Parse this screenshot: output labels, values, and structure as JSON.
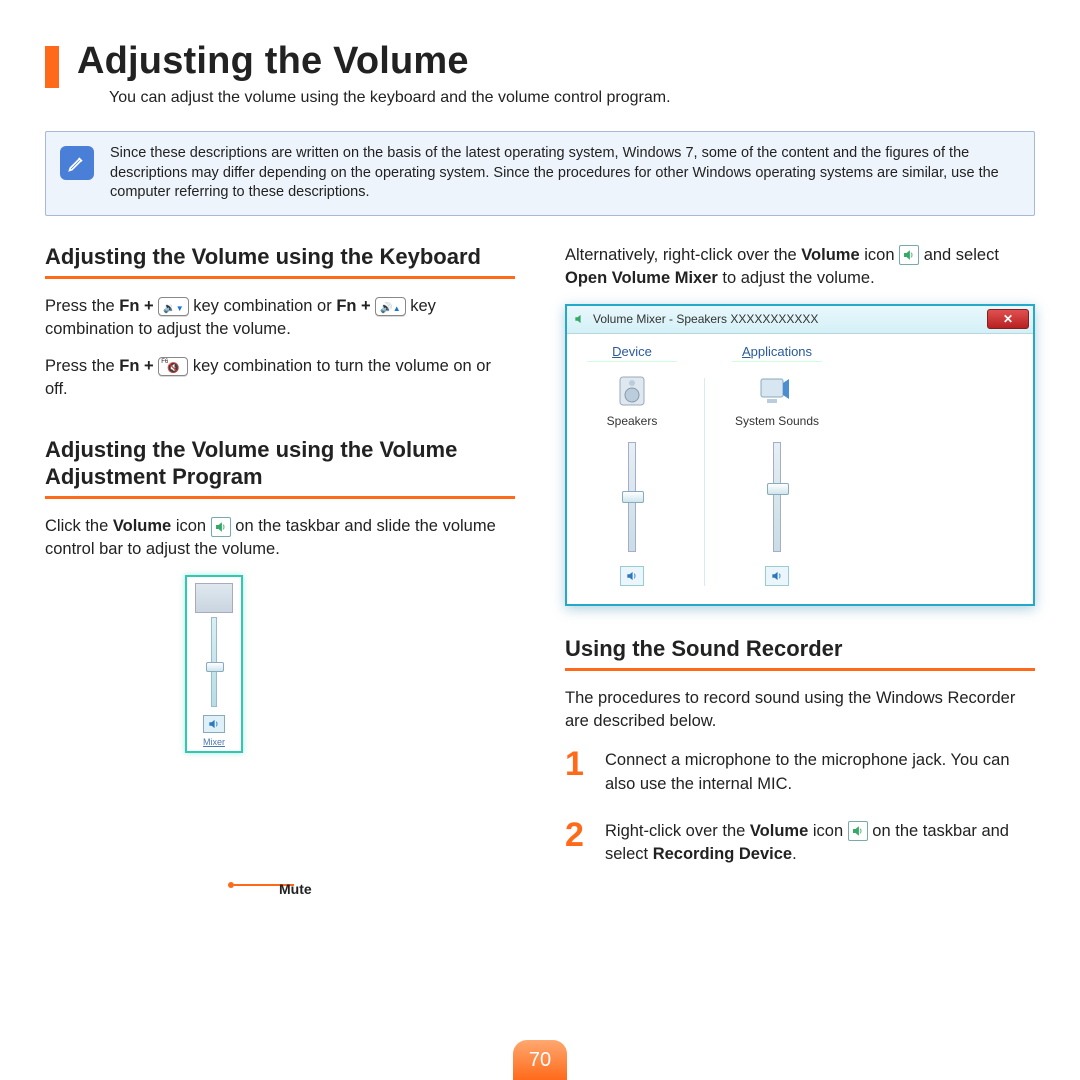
{
  "page_number": "70",
  "title": "Adjusting the Volume",
  "intro": "You can adjust the volume using the keyboard and the volume control program.",
  "note": "Since these descriptions are written on the basis of the latest operating system, Windows 7, some of the content and the figures of the descriptions may differ depending on the operating system. Since the procedures for other Windows operating systems are similar, use the computer referring to these descriptions.",
  "left": {
    "h_keyboard": "Adjusting the Volume using the Keyboard",
    "p1_a": "Press the ",
    "p1_b": "Fn + ",
    "p1_c": " key combination or ",
    "p1_d": "Fn + ",
    "p1_e": " key combination to adjust the volume.",
    "p2_a": "Press the ",
    "p2_b": "Fn + ",
    "p2_c": " key combination to turn the volume on or off.",
    "h_program": "Adjusting the Volume using the Volume Adjustment Program",
    "p3_a": "Click the ",
    "p3_b": "Volume",
    "p3_c": " icon ",
    "p3_d": " on the taskbar and slide the volume control bar to adjust the volume.",
    "mute": "Mute",
    "mixer_link": "Mixer"
  },
  "right": {
    "p1_a": "Alternatively, right-click over the ",
    "p1_b": "Volume",
    "p1_c": " icon ",
    "p1_d": " and select ",
    "p1_e": "Open Volume Mixer",
    "p1_f": " to adjust the volume.",
    "mixer": {
      "title": "Volume Mixer - Speakers  XXXXXXXXXXX",
      "col1_hdr": "Device",
      "col1_label": "Speakers",
      "col2_hdr": "Applications",
      "col2_label": "System Sounds"
    },
    "h_recorder": "Using the Sound Recorder",
    "p_recorder": "The procedures to record sound using the Windows Recorder are described below.",
    "steps": {
      "s1_num": "1",
      "s1_a": "Connect a microphone to the microphone jack. You can also use the internal MIC.",
      "s2_num": "2",
      "s2_a": "Right-click over the ",
      "s2_b": "Volume",
      "s2_c": " icon ",
      "s2_d": " on the taskbar and select ",
      "s2_e": "Recording Device",
      "s2_f": "."
    }
  },
  "keys": {
    "f6": "F6",
    "vol_down_arrow": "←",
    "vol_up_arrow": "→"
  }
}
